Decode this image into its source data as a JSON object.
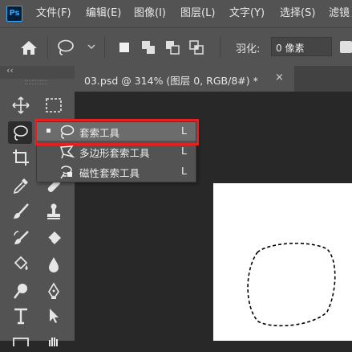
{
  "app": {
    "logo_text": "Ps"
  },
  "menu": [
    "文件(F)",
    "编辑(E)",
    "图像(I)",
    "图层(L)",
    "文字(Y)",
    "选择(S)",
    "滤镜"
  ],
  "options_bar": {
    "home_icon": "home-icon",
    "tool_preset_icon": "lasso-icon",
    "selection_modes": [
      "new-selection",
      "add-to-selection",
      "subtract-from-selection",
      "intersect-with-selection"
    ],
    "feather_label": "羽化:",
    "feather_value": "0 像素"
  },
  "toolbox": {
    "collapse_glyph": "‹‹",
    "tools": [
      "move-tool",
      "marquee-tool",
      "lasso-tool",
      "crop-tool",
      "eyedropper-tool",
      "brush-tool",
      "stamp-tool",
      "history-brush-tool",
      "eraser-tool",
      "paint-bucket-tool",
      "blur-tool",
      "dodge-tool",
      "pen-tool",
      "type-tool",
      "path-selection-tool",
      "rectangle-tool",
      "hand-tool"
    ]
  },
  "document": {
    "tab_label": "03.psd @ 314% (图层 0, RGB/8#) *",
    "close_glyph": "×"
  },
  "flyout": {
    "items": [
      {
        "label": "套索工具",
        "key": "L",
        "selected": true
      },
      {
        "label": "多边形套索工具",
        "key": "L",
        "selected": false
      },
      {
        "label": "磁性套索工具",
        "key": "L",
        "selected": false
      }
    ]
  },
  "colors": {
    "menubar": "#535353",
    "canvas_bg": "#282828",
    "highlight": "#e81f1f"
  }
}
